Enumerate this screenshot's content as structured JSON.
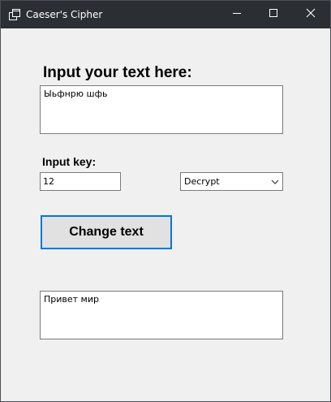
{
  "window": {
    "title": "Caeser's Cipher",
    "titlebar_color": "#2b2f33",
    "client_color": "#f0f0f0"
  },
  "icons": {
    "app": "app-window-icon",
    "minimize": "minimize-icon",
    "maximize": "maximize-icon",
    "close": "close-icon",
    "dropdown": "chevron-down-icon"
  },
  "form": {
    "input_heading": "Input your text here:",
    "input_text": "Ыьфнрю шфь",
    "key_label": "Input key:",
    "key_value": "12",
    "mode_selected": "Decrypt",
    "change_button_label": "Change text",
    "output_text": "Привет мир",
    "accent_color": "#0078d7"
  }
}
